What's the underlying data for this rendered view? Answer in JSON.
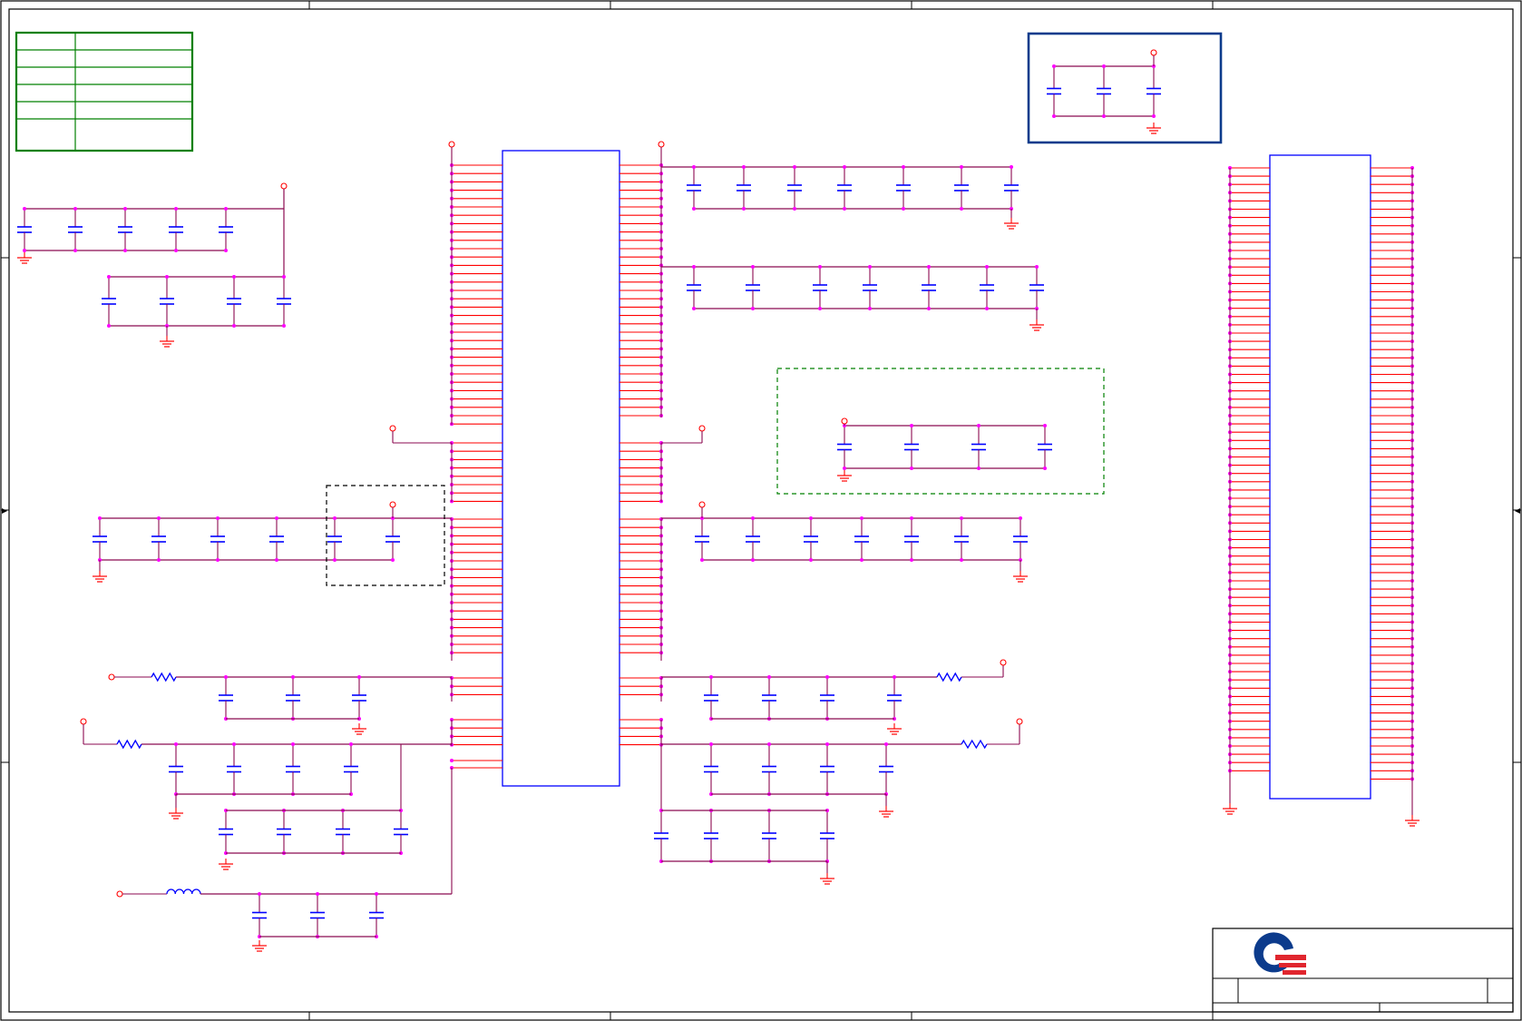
{
  "colors": {
    "wire": "#8b0a50",
    "pin": "#ff0000",
    "part": "#0000ff",
    "junction": "#ff00ff",
    "frame": "#000000",
    "table": "#008000",
    "group": "#0c3b8c",
    "dashed_green": "#008000",
    "logo_blue": "#0c3b8c",
    "logo_red": "#e0262e"
  },
  "logo": {
    "text": "Q"
  }
}
